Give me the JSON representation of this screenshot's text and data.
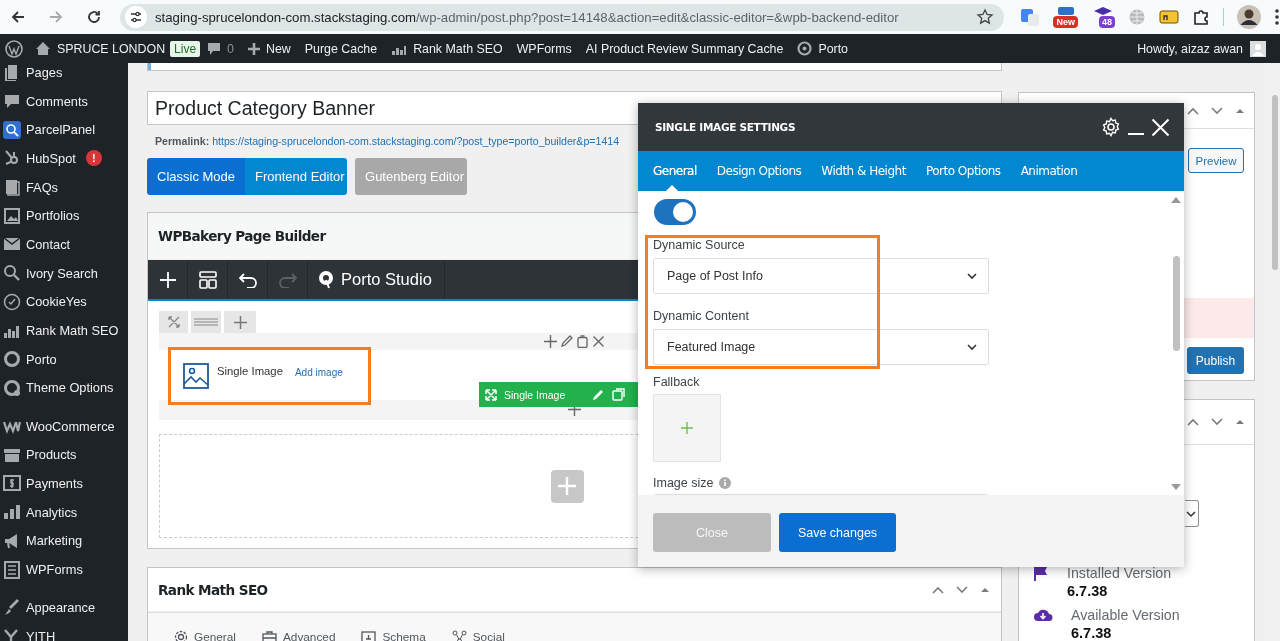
{
  "browser": {
    "url_host": "staging-sprucelondon-com.stackstaging.com",
    "url_path": "/wp-admin/post.php?post=14148&action=edit&classic-editor=&wpb-backend-editor",
    "extension_badges": [
      {
        "text": "New",
        "color": "#d93025"
      },
      {
        "text": "48",
        "color": "#7b3fd1"
      }
    ]
  },
  "admin_bar": {
    "site": "SPRUCE LONDON",
    "status": "Live",
    "comments": "0",
    "links": [
      "New",
      "Purge Cache",
      "Rank Math SEO",
      "WPForms",
      "AI Product Review Summary Cache",
      "Porto"
    ],
    "greeting": "Howdy, aizaz awan"
  },
  "sidebar": {
    "groups": [
      {
        "items": [
          {
            "label": "Pages"
          },
          {
            "label": "Comments"
          },
          {
            "label": "ParcelPanel"
          },
          {
            "label": "HubSpot",
            "badge": "!"
          },
          {
            "label": "FAQs"
          },
          {
            "label": "Portfolios"
          },
          {
            "label": "Contact"
          },
          {
            "label": "Ivory Search"
          },
          {
            "label": "CookieYes"
          },
          {
            "label": "Rank Math SEO"
          },
          {
            "label": "Porto"
          },
          {
            "label": "Theme Options"
          }
        ]
      },
      {
        "items": [
          {
            "label": "WooCommerce"
          },
          {
            "label": "Products"
          },
          {
            "label": "Payments"
          },
          {
            "label": "Analytics"
          },
          {
            "label": "Marketing"
          },
          {
            "label": "WPForms"
          }
        ]
      },
      {
        "items": [
          {
            "label": "Appearance"
          },
          {
            "label": "YITH"
          }
        ]
      }
    ]
  },
  "editor": {
    "title": "Product Category Banner",
    "permalink_label": "Permalink:",
    "permalink_url": "https://staging-sprucelondon-com.stackstaging.com/?post_type=porto_builder&p=1414",
    "modes": [
      {
        "label": "Classic Mode",
        "kind": "primary"
      },
      {
        "label": "Frontend Editor",
        "kind": "secondary"
      },
      {
        "label": "Gutenberg Editor",
        "kind": "muted"
      }
    ]
  },
  "page_builder": {
    "title": "WPBakery Page Builder",
    "studio": "Porto Studio",
    "element": {
      "name": "Single Image",
      "link": "Add image",
      "highlighted": true
    },
    "element_toolbar": "Single Image"
  },
  "rank_math": {
    "title": "Rank Math SEO",
    "tabs": [
      "General",
      "Advanced",
      "Schema",
      "Social"
    ]
  },
  "publish_box": {
    "preview": "Preview",
    "publish": "Publish"
  },
  "version_box": {
    "versions": [
      {
        "label": "Installed Version",
        "value": "6.7.38"
      },
      {
        "label": "Available Version",
        "value": "6.7.38"
      }
    ]
  },
  "modal": {
    "title": "SINGLE IMAGE SETTINGS",
    "tabs": [
      {
        "label": "General",
        "selected": true
      },
      {
        "label": "Design Options",
        "selected": false
      },
      {
        "label": "Width & Height",
        "selected": false
      },
      {
        "label": "Porto Options",
        "selected": false
      },
      {
        "label": "Animation",
        "selected": false
      }
    ],
    "dynamic_toggle": {
      "on": true
    },
    "fields": [
      {
        "label": "Dynamic Source",
        "value": "Page of Post Info"
      },
      {
        "label": "Dynamic Content",
        "value": "Featured Image"
      }
    ],
    "fields_highlighted": true,
    "fallback": "Fallback",
    "image_size": "Image size",
    "buttons": [
      {
        "label": "Close",
        "kind": "secondary"
      },
      {
        "label": "Save changes",
        "kind": "primary"
      }
    ]
  }
}
